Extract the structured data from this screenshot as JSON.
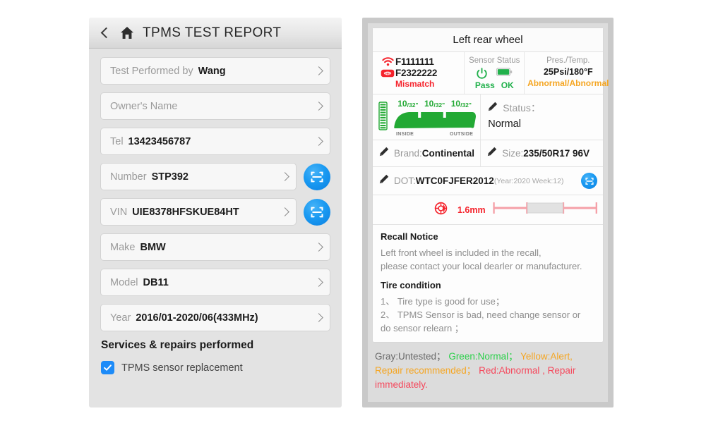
{
  "left": {
    "titlebar": {
      "back": "back-chevron",
      "home": "home-icon",
      "title": "TPMS TEST REPORT"
    },
    "fields": [
      {
        "label": "Test Performed by",
        "value": "Wang",
        "scan": false
      },
      {
        "label": "Owner's Name",
        "value": "",
        "scan": false
      },
      {
        "label": "Tel",
        "value": "13423456787",
        "scan": false
      },
      {
        "label": "Number",
        "value": "STP392",
        "scan": true
      },
      {
        "label": "VIN",
        "value": "UIE8378HFSKUE84HT",
        "scan": true
      },
      {
        "label": "Make",
        "value": "BMW",
        "scan": false
      },
      {
        "label": "Model",
        "value": "DB11",
        "scan": false
      },
      {
        "label": "Year",
        "value": "2016/01-2020/06(433MHz)",
        "scan": false
      }
    ],
    "services_heading": "Services & repairs performed",
    "services": [
      {
        "label": "TPMS sensor replacement",
        "checked": true
      }
    ]
  },
  "right": {
    "wheel_title": "Left rear wheel",
    "sensor": {
      "id_primary": "F1111111",
      "id_secondary": "F2322222",
      "match_status": "Mismatch",
      "match_color": "#f5232c"
    },
    "sensor_status": {
      "header": "Sensor Status",
      "power_label": "Pass",
      "battery_label": "OK",
      "ok_color": "#22b14c"
    },
    "pressure_temp": {
      "header": "Pres./Temp.",
      "value": "25Psi/180°F",
      "status": "Abnormal/Abnormal",
      "status_color": "#f5a623"
    },
    "tread": {
      "depths": [
        "10",
        "10",
        "10"
      ],
      "unit": "/32\"",
      "inside_label": "INSIDE",
      "outside_label": "OUTSIDE",
      "color": "#22a934"
    },
    "status": {
      "label": "Status：",
      "value": "Normal"
    },
    "brand": {
      "label": "Brand:",
      "value": "Continental"
    },
    "size": {
      "label": "Size:",
      "value": "235/50R17 96V"
    },
    "dot": {
      "label": "DOT:",
      "value": "WTC0FJFER2012",
      "detail": "(Year:2020 Week:12)"
    },
    "measurement": {
      "value": "1.6mm",
      "color": "#f5232c"
    },
    "recall": {
      "heading": "Recall Notice",
      "lines": [
        "Left front wheel is included in the recall,",
        "please contact your local dearler or manufacturer."
      ]
    },
    "tire_condition": {
      "heading": "Tire condition",
      "lines": [
        "1、 Tire type is good for use；",
        "2、 TPMS Sensor is bad,   need change sensor or",
        "do sensor relearn ；"
      ]
    },
    "legend": {
      "gray": "Gray:Untested；",
      "green": "Green:Normal；",
      "yellow": "Yellow:Alert, Repair recommended；",
      "red": "Red:Abnormal , Repair immediately."
    }
  }
}
